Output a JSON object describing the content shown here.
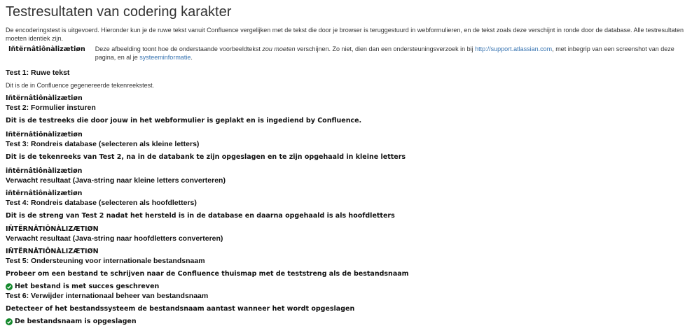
{
  "title": "Testresultaten van codering karakter",
  "intro": "De encoderingstest is uitgevoerd. Hieronder kun je de ruwe tekst vanuit Confluence vergelijken met de tekst die door je browser is teruggestuurd in webformulieren, en de tekst zoals deze verschijnt in ronde door de database. Alle testresultaten moeten identiek zijn.",
  "sample": {
    "image_text": "Iñtërnâtiônàlizætiøn",
    "desc_before": "Deze afbeelding toont hoe de onderstaande voorbeeldtekst ",
    "desc_em": "zou moeten",
    "desc_mid": " verschijnen. Zo niet, dien dan een ondersteuningsverzoek in bij ",
    "support_link": "http://support.atlassian.com",
    "desc_after": ", met inbegrip van een screenshot van deze pagina, en al je ",
    "sysinfo_link": "systeeminformatie",
    "desc_end": "."
  },
  "tests": {
    "t1_title": "Test 1: Ruwe tekst",
    "t1_desc": "Dit is de in Confluence gegenereerde tekenreekstest.",
    "t1_value": "Iñtërnâtiônàlizætiøn",
    "t2_title": "Test 2: Formulier insturen",
    "t2_desc": "Dit is de testreeks die door jouw in het webformulier is geplakt en is ingediend by Confluence.",
    "t2_value": "Iñtërnâtiônàlizætiøn",
    "t3_title": "Test 3: Rondreis database (selecteren als kleine letters)",
    "t3_desc": "Dit is de tekenreeks van Test 2, na in de databank te zijn opgeslagen en te zijn opgehaald in kleine letters",
    "t3_value": "iñtërnâtiônàlizætiøn",
    "t3_expected_title": "Verwacht resultaat (Java-string naar kleine letters converteren)",
    "t3_expected_value": "iñtërnâtiônàlizætiøn",
    "t4_title": "Test 4: Rondreis database (selecteren als hoofdletters)",
    "t4_desc": "Dit is de streng van Test 2 nadat het hersteld is in de database en daarna opgehaald is als hoofdletters",
    "t4_value": "IÑTËRNÂTIÔNÀLIZÆTIØN",
    "t4_expected_title": "Verwacht resultaat (Java-string naar hoofdletters converteren)",
    "t4_expected_value": "IÑTËRNÂTIÔNÀLIZÆTIØN",
    "t5_title": "Test 5: Ondersteuning voor internationale bestandsnaam",
    "t5_desc": "Probeer om een bestand te schrijven naar de Confluence thuismap met de teststreng als de bestandsnaam",
    "t5_result": "Het bestand is met succes geschreven",
    "t6_title": "Test 6: Verwijder internationaal beheer van bestandsnaam",
    "t6_desc": "Detecteer of het bestandssysteem de bestandsnaam aantast wanneer het wordt opgeslagen",
    "t6_result": "De bestandsnaam is opgeslagen"
  },
  "colors": {
    "link": "#3572b0",
    "success": "#14892c"
  }
}
